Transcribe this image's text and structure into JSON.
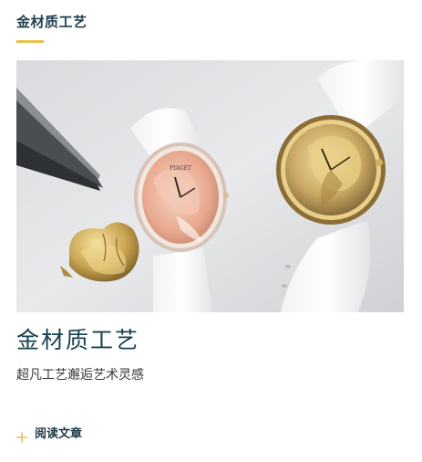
{
  "section": {
    "title": "金材质工艺"
  },
  "article": {
    "title": "金材质工艺",
    "subtitle": "超凡工艺邂逅艺术灵感",
    "read_label": "阅读文章",
    "watch_brand_mark": "PIAGET"
  },
  "colors": {
    "accent": "#e8c14d",
    "title": "#18414f",
    "text": "#333a3d"
  },
  "icons": {
    "read_link": "plus-icon"
  }
}
